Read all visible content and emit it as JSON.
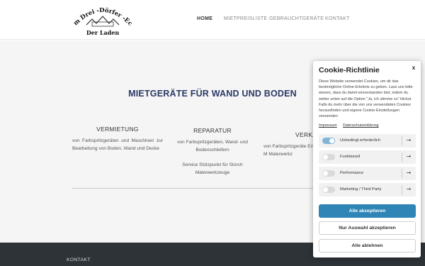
{
  "header": {
    "logo": {
      "line1": "Am Drei -Dörfer -Eck",
      "line2": "Der Laden"
    },
    "nav": [
      "HOME",
      "MIETPREISLISTE",
      "GEBRAUCHTGERÄTE",
      "KONTAKT"
    ]
  },
  "hero": {
    "title": "MIETGERÄTE FÜR WAND UND BODEN",
    "columns": [
      {
        "title": "VERMIETUNG",
        "text": "von Farbspritzgeräten und Maschinen zur Bearbeitung von Boden, Wand und Decke"
      },
      {
        "title": "REPARATUR",
        "text": "von Farbspritzgeräten, Wand- und Bodenschleifern",
        "text2": "Service Stützpunkt für Storch Malerwerkzeuge"
      },
      {
        "title": "VERKA",
        "text": "von Farbspritzgeräte Ersatzteilen sowie M Malerwerkz"
      }
    ]
  },
  "footer": {
    "label": "KONTAKT"
  },
  "cookie": {
    "title": "Cookie-Richtlinie",
    "close": "x",
    "text": "Diese Website verwendet Cookies, um dir das bestmögliche Online-Erlebnis zu geben. Lass uns bitte wissen, dass du damit einverstanden bist, indem du weiter unten auf die Option \"Ja, ich stimme zu\" klickst. Falls du mehr über die von uns verwendeten Cookies herausfinden und eigene Cookie-Einstellungen verwenden",
    "links": [
      "Impressum",
      "Datenschutzerklärung"
    ],
    "options": [
      {
        "label": "Unbedingt erforderlich",
        "enabled": true
      },
      {
        "label": "Funktionell",
        "enabled": false
      },
      {
        "label": "Performance",
        "enabled": false
      },
      {
        "label": "Marketing / Third Party",
        "enabled": false
      }
    ],
    "buttons": {
      "accept_all": "Alle akzeptieren",
      "accept_selection": "Nur Auswahl akzeptieren",
      "reject_all": "Alle ablehnen"
    },
    "colors": {
      "primary": "#2f86b6",
      "toggle_on": "#7fb6d8"
    }
  }
}
